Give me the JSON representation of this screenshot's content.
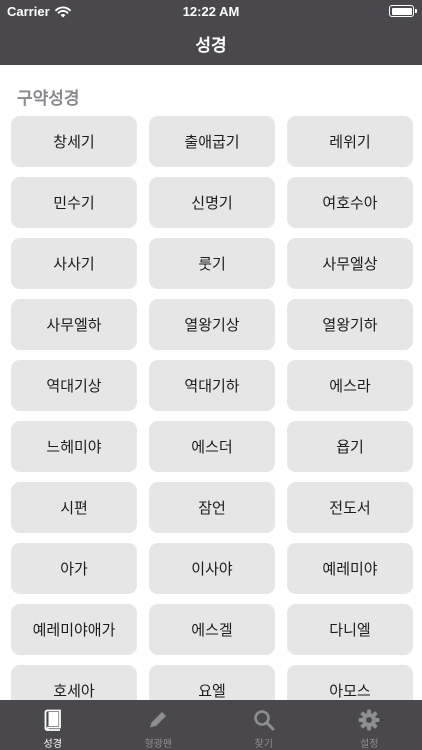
{
  "status_bar": {
    "carrier": "Carrier",
    "time": "12:22 AM"
  },
  "nav": {
    "title": "성경"
  },
  "section": {
    "title": "구약성경"
  },
  "books": [
    "창세기",
    "출애굽기",
    "레위기",
    "민수기",
    "신명기",
    "여호수아",
    "사사기",
    "룻기",
    "사무엘상",
    "사무엘하",
    "열왕기상",
    "열왕기하",
    "역대기상",
    "역대기하",
    "에스라",
    "느헤미야",
    "에스더",
    "욥기",
    "시편",
    "잠언",
    "전도서",
    "아가",
    "이사야",
    "예레미야",
    "예레미야애가",
    "에스겔",
    "다니엘",
    "호세아",
    "요엘",
    "아모스"
  ],
  "tabs": [
    {
      "label": "성경",
      "icon": "book-icon",
      "active": true
    },
    {
      "label": "형광펜",
      "icon": "pencil-icon",
      "active": false
    },
    {
      "label": "찾기",
      "icon": "search-icon",
      "active": false
    },
    {
      "label": "설정",
      "icon": "gear-icon",
      "active": false
    }
  ],
  "colors": {
    "bar_background": "#4a484d",
    "tab_active": "#ffffff",
    "tab_inactive": "#8e8d92",
    "button_background": "#e6e6e6",
    "section_text": "#8a8a8e"
  }
}
